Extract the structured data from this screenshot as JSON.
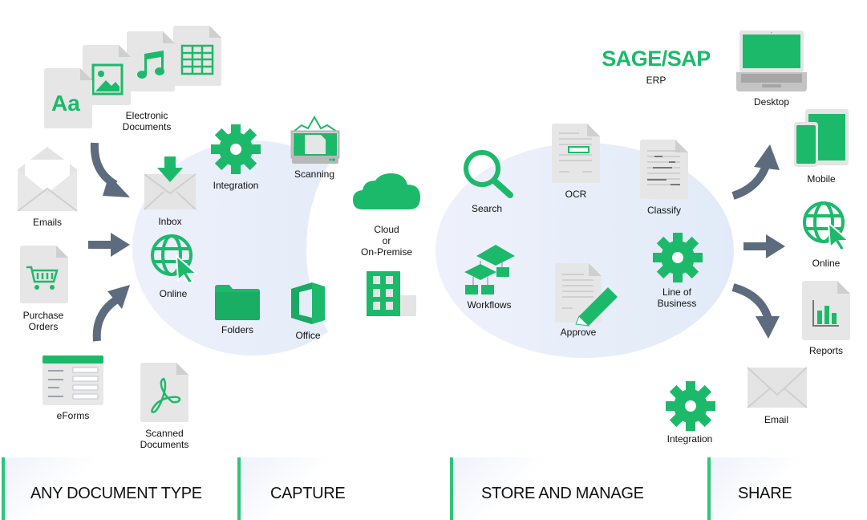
{
  "colors": {
    "accent_green": "#1db96b",
    "arrow_gray": "#5d6b7e",
    "doc_gray": "#e6e6e6",
    "blob_blue": "#e8eefb"
  },
  "sources": {
    "electronic_documents": {
      "label_line1": "Electronic",
      "label_line2": "Documents"
    },
    "emails": {
      "label": "Emails"
    },
    "purchase_orders": {
      "label_line1": "Purchase",
      "label_line2": "Orders"
    },
    "eforms": {
      "label": "eForms"
    },
    "scanned_documents": {
      "label_line1": "Scanned",
      "label_line2": "Documents"
    },
    "doc_icon_text": "Aa"
  },
  "capture": {
    "inbox": {
      "label": "Inbox"
    },
    "integration": {
      "label": "Integration"
    },
    "scanning": {
      "label": "Scanning"
    },
    "online": {
      "label": "Online"
    },
    "folders": {
      "label": "Folders"
    },
    "office": {
      "label": "Office"
    }
  },
  "deployment": {
    "label_line1": "Cloud",
    "label_line2": "or",
    "label_line3": "On-Premise"
  },
  "manage": {
    "search": {
      "label": "Search"
    },
    "ocr": {
      "label": "OCR"
    },
    "classify": {
      "label": "Classify"
    },
    "workflows": {
      "label": "Workflows"
    },
    "approve": {
      "label": "Approve"
    },
    "line_of_business": {
      "label_line1": "Line of",
      "label_line2": "Business"
    }
  },
  "erp": {
    "title": "SAGE/SAP",
    "subtitle": "ERP"
  },
  "share": {
    "desktop": {
      "label": "Desktop"
    },
    "mobile": {
      "label": "Mobile"
    },
    "online": {
      "label": "Online"
    },
    "reports": {
      "label": "Reports"
    },
    "email": {
      "label": "Email"
    },
    "integration": {
      "label": "Integration"
    }
  },
  "stages": [
    {
      "label": "ANY DOCUMENT TYPE"
    },
    {
      "label": "CAPTURE"
    },
    {
      "label": "STORE AND MANAGE"
    },
    {
      "label": "SHARE"
    }
  ]
}
